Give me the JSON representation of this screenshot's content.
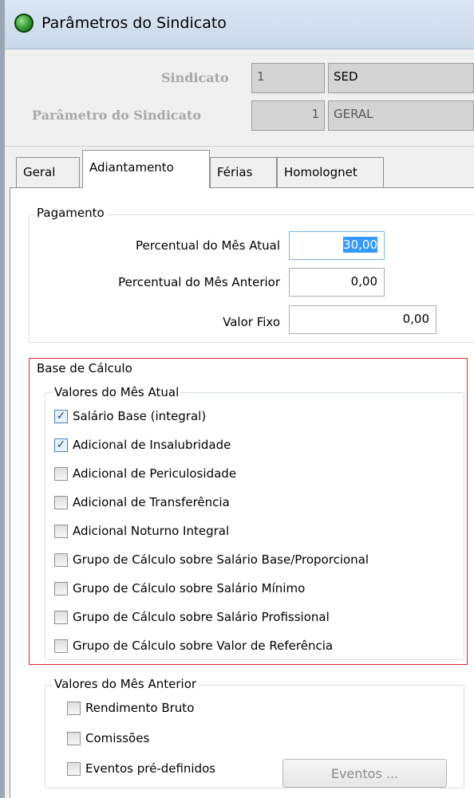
{
  "window": {
    "title": "Parâmetros do Sindicato"
  },
  "header": {
    "sindicato": {
      "label": "Sindicato",
      "code": "1",
      "name": "SED"
    },
    "parametro": {
      "label": "Parâmetro do Sindicato",
      "code": "1",
      "name": "GERAL"
    }
  },
  "tabs": [
    {
      "label": "Geral",
      "active": false
    },
    {
      "label": "Adiantamento",
      "active": true
    },
    {
      "label": "Férias",
      "active": false
    },
    {
      "label": "Homolognet",
      "active": false
    }
  ],
  "pagamento": {
    "legend": "Pagamento",
    "percentual_atual": {
      "label": "Percentual do Mês Atual",
      "value": "30,00"
    },
    "percentual_anterior": {
      "label": "Percentual do Mês Anterior",
      "value": "0,00"
    },
    "valor_fixo": {
      "label": "Valor Fixo",
      "value": "0,00"
    }
  },
  "base_calculo": {
    "legend": "Base de Cálculo",
    "mes_atual": {
      "legend": "Valores do Mês Atual",
      "items": [
        {
          "label": "Salário Base (integral)",
          "checked": true
        },
        {
          "label": "Adicional de Insalubridade",
          "checked": true
        },
        {
          "label": "Adicional de Periculosidade",
          "checked": false
        },
        {
          "label": "Adicional de Transferência",
          "checked": false
        },
        {
          "label": "Adicional Noturno Integral",
          "checked": false
        },
        {
          "label": "Grupo de Cálculo sobre Salário Base/Proporcional",
          "checked": false
        },
        {
          "label": "Grupo de Cálculo sobre Salário Mínimo",
          "checked": false
        },
        {
          "label": "Grupo de Cálculo sobre Salário Profissional",
          "checked": false
        },
        {
          "label": "Grupo de Cálculo sobre Valor de Referência",
          "checked": false
        }
      ]
    },
    "mes_anterior": {
      "legend": "Valores do Mês Anterior",
      "items": [
        {
          "label": "Rendimento Bruto",
          "checked": false
        },
        {
          "label": "Comissões",
          "checked": false
        },
        {
          "label": "Eventos pré-definidos",
          "checked": false
        }
      ],
      "eventos_button": "Eventos ..."
    }
  },
  "colors": {
    "highlight_box": "#e0262f",
    "selection": "#3399ff",
    "titlebar": "#c9d8ea"
  }
}
